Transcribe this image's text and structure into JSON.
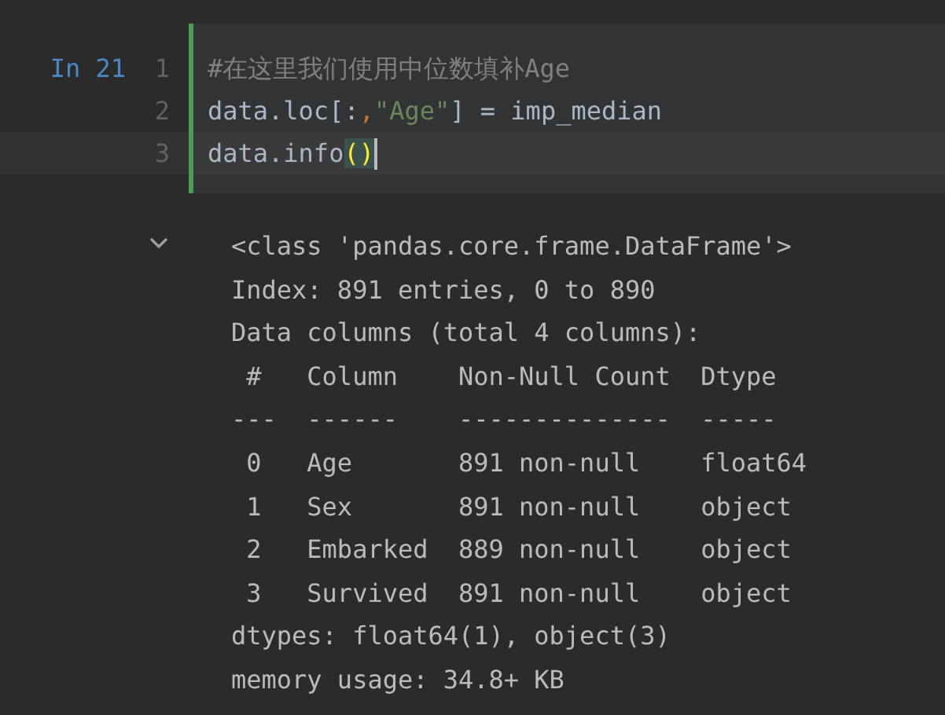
{
  "cell": {
    "prompt": "In 21",
    "lines": [
      {
        "number": "1",
        "current": false,
        "tokens": [
          {
            "kind": "comment",
            "text": "#在这里我们使用中位数填补Age"
          }
        ]
      },
      {
        "number": "2",
        "current": false,
        "tokens": [
          {
            "kind": "code",
            "text": "data.loc[:"
          },
          {
            "kind": "punct",
            "text": ","
          },
          {
            "kind": "string",
            "text": "\"Age\""
          },
          {
            "kind": "code",
            "text": "] = imp_median"
          }
        ]
      },
      {
        "number": "3",
        "current": true,
        "tokens": [
          {
            "kind": "code",
            "text": "data.info"
          },
          {
            "kind": "match",
            "text": "()"
          }
        ]
      }
    ]
  },
  "output": {
    "expanded": true,
    "lines": [
      "<class 'pandas.core.frame.DataFrame'>",
      "Index: 891 entries, 0 to 890",
      "Data columns (total 4 columns):",
      " #   Column    Non-Null Count  Dtype  ",
      "---  ------    --------------  -----  ",
      " 0   Age       891 non-null    float64",
      " 1   Sex       891 non-null    object ",
      " 2   Embarked  889 non-null    object ",
      " 3   Survived  891 non-null    object ",
      "dtypes: float64(1), object(3)",
      "memory usage: 34.8+ KB"
    ]
  }
}
